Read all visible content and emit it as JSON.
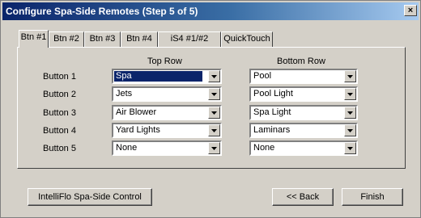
{
  "window": {
    "title": "Configure Spa-Side Remotes (Step 5 of 5)",
    "close_label": "×"
  },
  "tabs": [
    {
      "label": "Btn #1",
      "active": true
    },
    {
      "label": "Btn #2"
    },
    {
      "label": "Btn #3"
    },
    {
      "label": "Btn #4"
    },
    {
      "label": "iS4 #1/#2"
    },
    {
      "label": "QuickTouch"
    }
  ],
  "columns": {
    "top": "Top Row",
    "bottom": "Bottom Row"
  },
  "rows": [
    {
      "label": "Button 1",
      "top": "Spa",
      "bottom": "Pool"
    },
    {
      "label": "Button 2",
      "top": "Jets",
      "bottom": "Pool Light"
    },
    {
      "label": "Button 3",
      "top": "Air Blower",
      "bottom": "Spa Light"
    },
    {
      "label": "Button 4",
      "top": "Yard Lights",
      "bottom": "Laminars"
    },
    {
      "label": "Button 5",
      "top": "None",
      "bottom": "None"
    }
  ],
  "buttons": {
    "intelliflo": "IntelliFlo Spa-Side Control",
    "back": "<< Back",
    "finish": "Finish"
  },
  "colors": {
    "title_start": "#0a246a",
    "title_end": "#a6caf0",
    "face": "#d4d0c8",
    "selection": "#0a246a"
  }
}
